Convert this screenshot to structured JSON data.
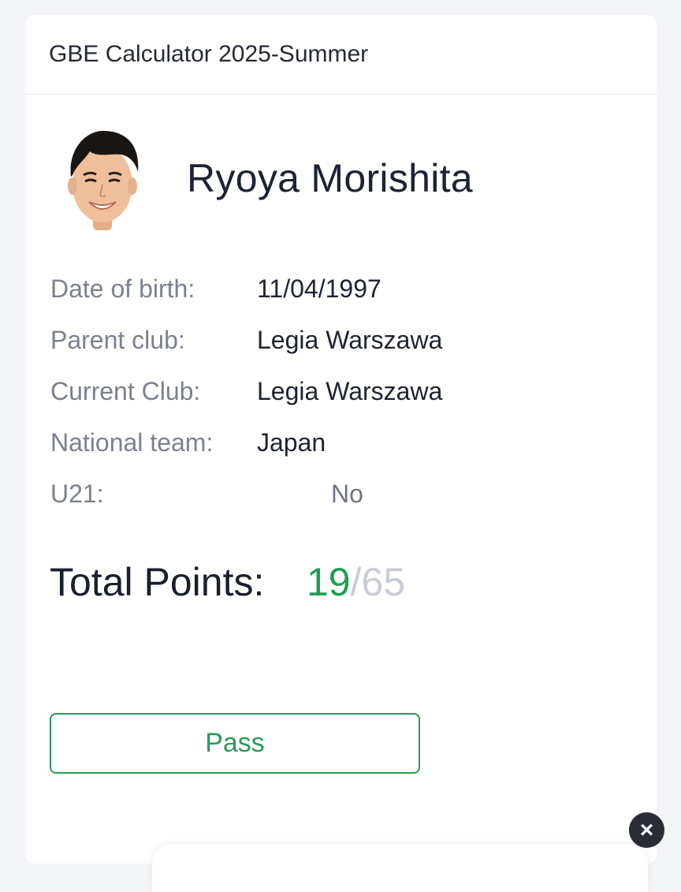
{
  "header": {
    "title": "GBE Calculator 2025-Summer"
  },
  "player": {
    "name": "Ryoya Morishita",
    "avatar_icon": "player-photo"
  },
  "details": {
    "dob_label": "Date of birth:",
    "dob_value": "11/04/1997",
    "parent_label": "Parent club:",
    "parent_value": "Legia Warszawa",
    "current_label": "Current Club:",
    "current_value": "Legia Warszawa",
    "national_label": "National team:",
    "national_value": "Japan",
    "u21_label": "U21:",
    "u21_value": "No"
  },
  "total": {
    "label": "Total Points:",
    "points": "19",
    "separator": "/",
    "max": "65"
  },
  "result_button": {
    "label": "Pass"
  },
  "close_button": {
    "icon": "close-icon",
    "glyph": "×"
  },
  "colors": {
    "accent_green": "#2a9a59",
    "muted": "#c9ccd6"
  }
}
